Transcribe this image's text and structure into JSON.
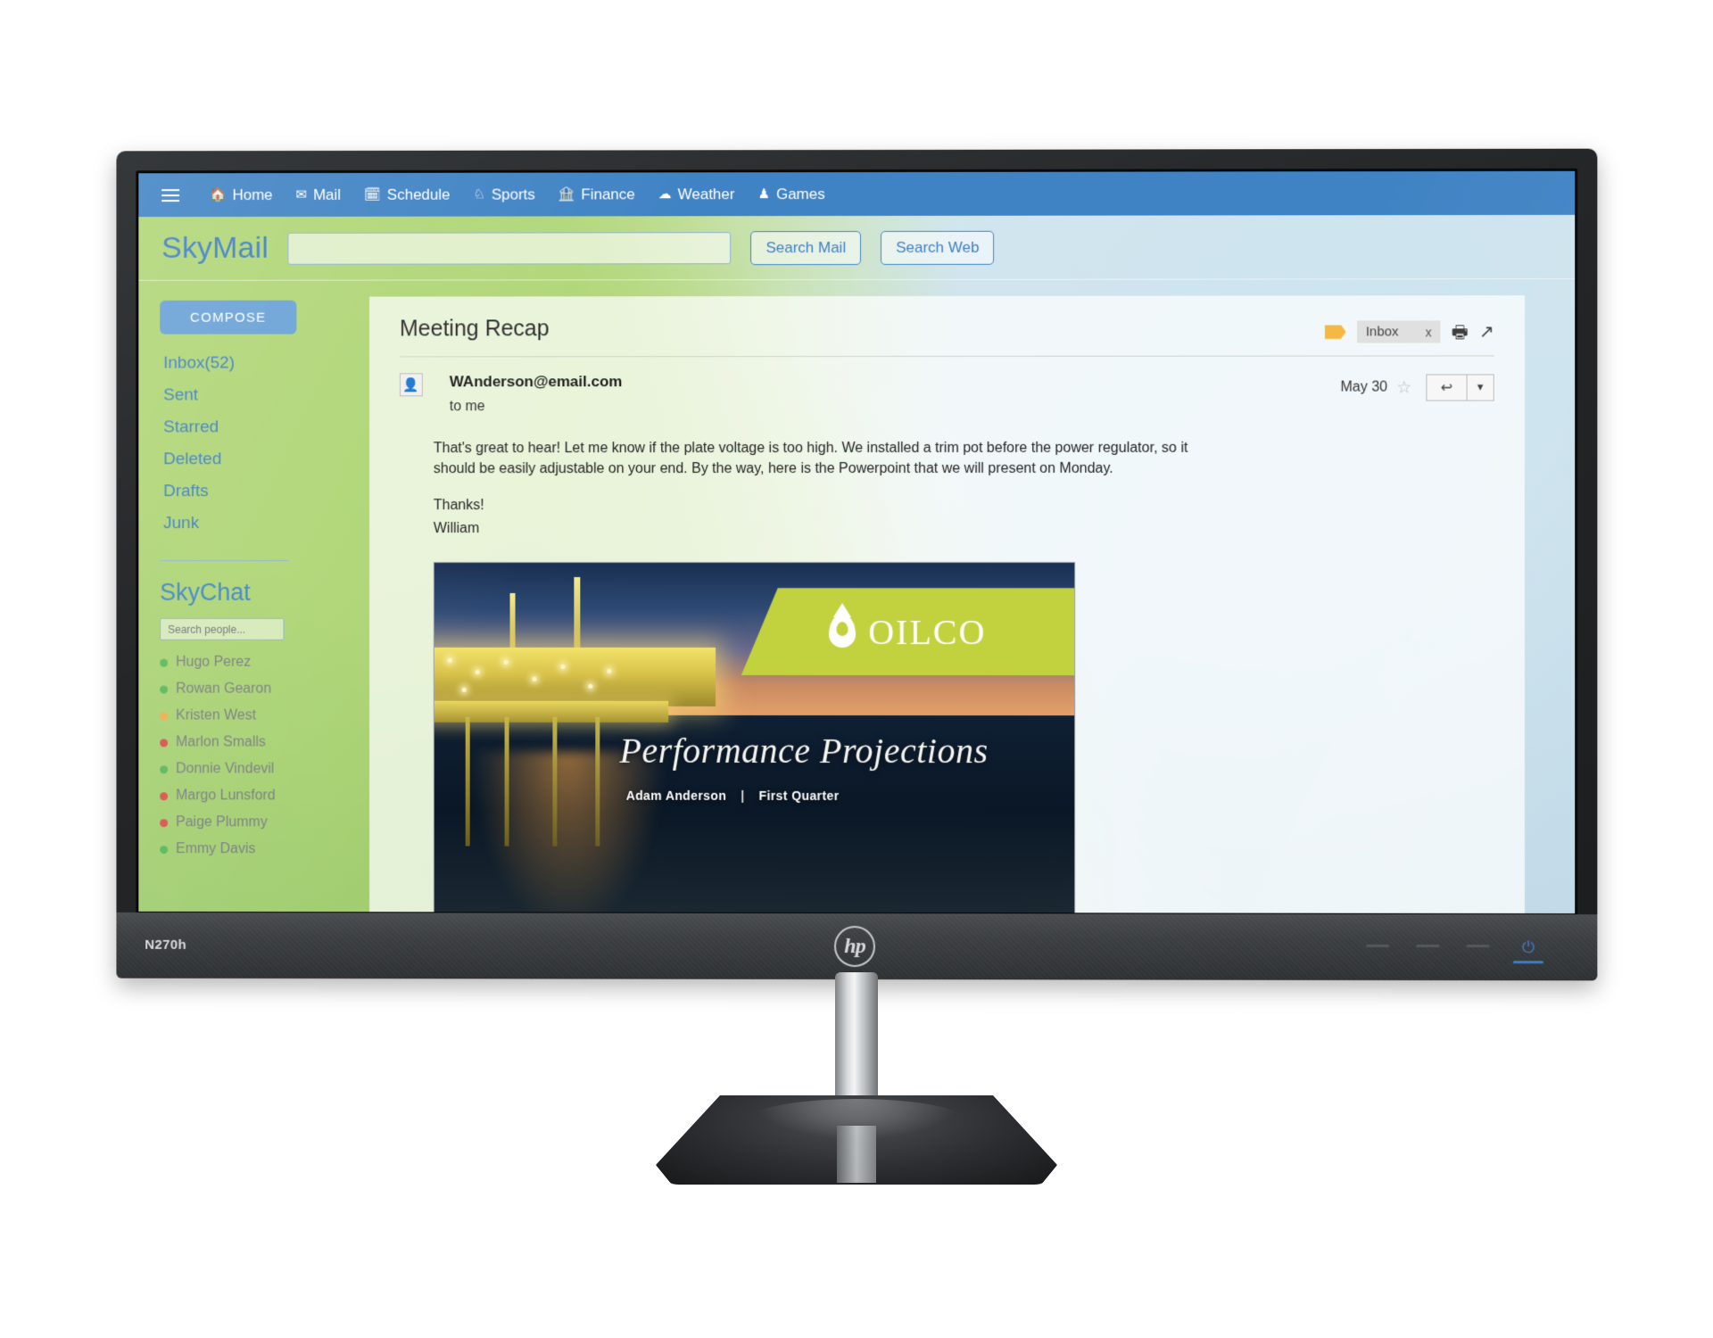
{
  "topnav": {
    "menu_icon": "hamburger-icon",
    "items": [
      {
        "label": "Home",
        "icon": "home-icon",
        "glyph": "⌂"
      },
      {
        "label": "Mail",
        "icon": "envelope-icon",
        "glyph": "✉"
      },
      {
        "label": "Schedule",
        "icon": "calendar-icon",
        "glyph": "Ὄ5"
      },
      {
        "label": "Sports",
        "icon": "trophy-icon",
        "glyph": "♕"
      },
      {
        "label": "Finance",
        "icon": "bank-icon",
        "glyph": "Ἶ6"
      },
      {
        "label": "Weather",
        "icon": "cloud-icon",
        "glyph": "☁"
      },
      {
        "label": "Games",
        "icon": "chess-pawn-icon",
        "glyph": "♟"
      }
    ]
  },
  "brand": {
    "name": "SkyMail",
    "search_value": "",
    "search_placeholder": "",
    "search_mail_label": "Search Mail",
    "search_web_label": "Search Web"
  },
  "sidebar": {
    "compose_label": "COMPOSE",
    "folders": [
      {
        "label": "Inbox(52)"
      },
      {
        "label": "Sent"
      },
      {
        "label": "Starred"
      },
      {
        "label": "Deleted"
      },
      {
        "label": "Drafts"
      },
      {
        "label": "Junk"
      }
    ],
    "chat": {
      "title": "SkyChat",
      "search_value": "",
      "search_placeholder": "Search people...",
      "people": [
        {
          "name": "Hugo Perez",
          "status_color": "#5cb85c"
        },
        {
          "name": "Rowan Gearon",
          "status_color": "#5cb85c"
        },
        {
          "name": "Kristen West",
          "status_color": "#f0ad4e"
        },
        {
          "name": "Marlon Smalls",
          "status_color": "#d9534f"
        },
        {
          "name": "Donnie Vindevil",
          "status_color": "#5cb85c"
        },
        {
          "name": "Margo Lunsford",
          "status_color": "#d9534f"
        },
        {
          "name": "Paige Plummy",
          "status_color": "#d9534f"
        },
        {
          "name": "Emmy Davis",
          "status_color": "#5cb85c"
        }
      ]
    }
  },
  "mail": {
    "subject": "Meeting Recap",
    "tag_icon": "label-tag-icon",
    "inbox_chip_label": "Inbox",
    "inbox_chip_close": "x",
    "print_icon": "printer-icon",
    "popout_icon": "open-in-new-window-icon",
    "sender_email": "WAnderson@email.com",
    "recipient": "to me",
    "date": "May 30",
    "star_icon": "star-outline-icon",
    "reply_icon": "reply-arrow-icon",
    "reply_caret_icon": "chevron-down-icon",
    "avatar_icon": "person-avatar-icon",
    "body_paragraph": "That's great to hear! Let me know if the plate voltage is too high. We installed a trim pot before the power regulator, so it should be easily adjustable on your end. By the way, here is the Powerpoint that we will present on Monday.",
    "signoff": "Thanks!",
    "signer": "William"
  },
  "slide": {
    "company": "OILCO",
    "logo_icon": "oil-drop-icon",
    "title": "Performance Projections",
    "author": "Adam Anderson",
    "separator": "|",
    "quarter": "First Quarter",
    "band_color": "#c2d23e"
  },
  "hardware": {
    "model": "N270h",
    "brand_logo": "hp-logo",
    "brand_text": "hp",
    "power_icon": "power-icon",
    "power_glyph": "⏻"
  },
  "colors": {
    "nav_blue": "#4083c4",
    "link_blue": "#3f7fc4",
    "compose_blue": "#6aa2d6",
    "tag_orange": "#f5b942"
  }
}
